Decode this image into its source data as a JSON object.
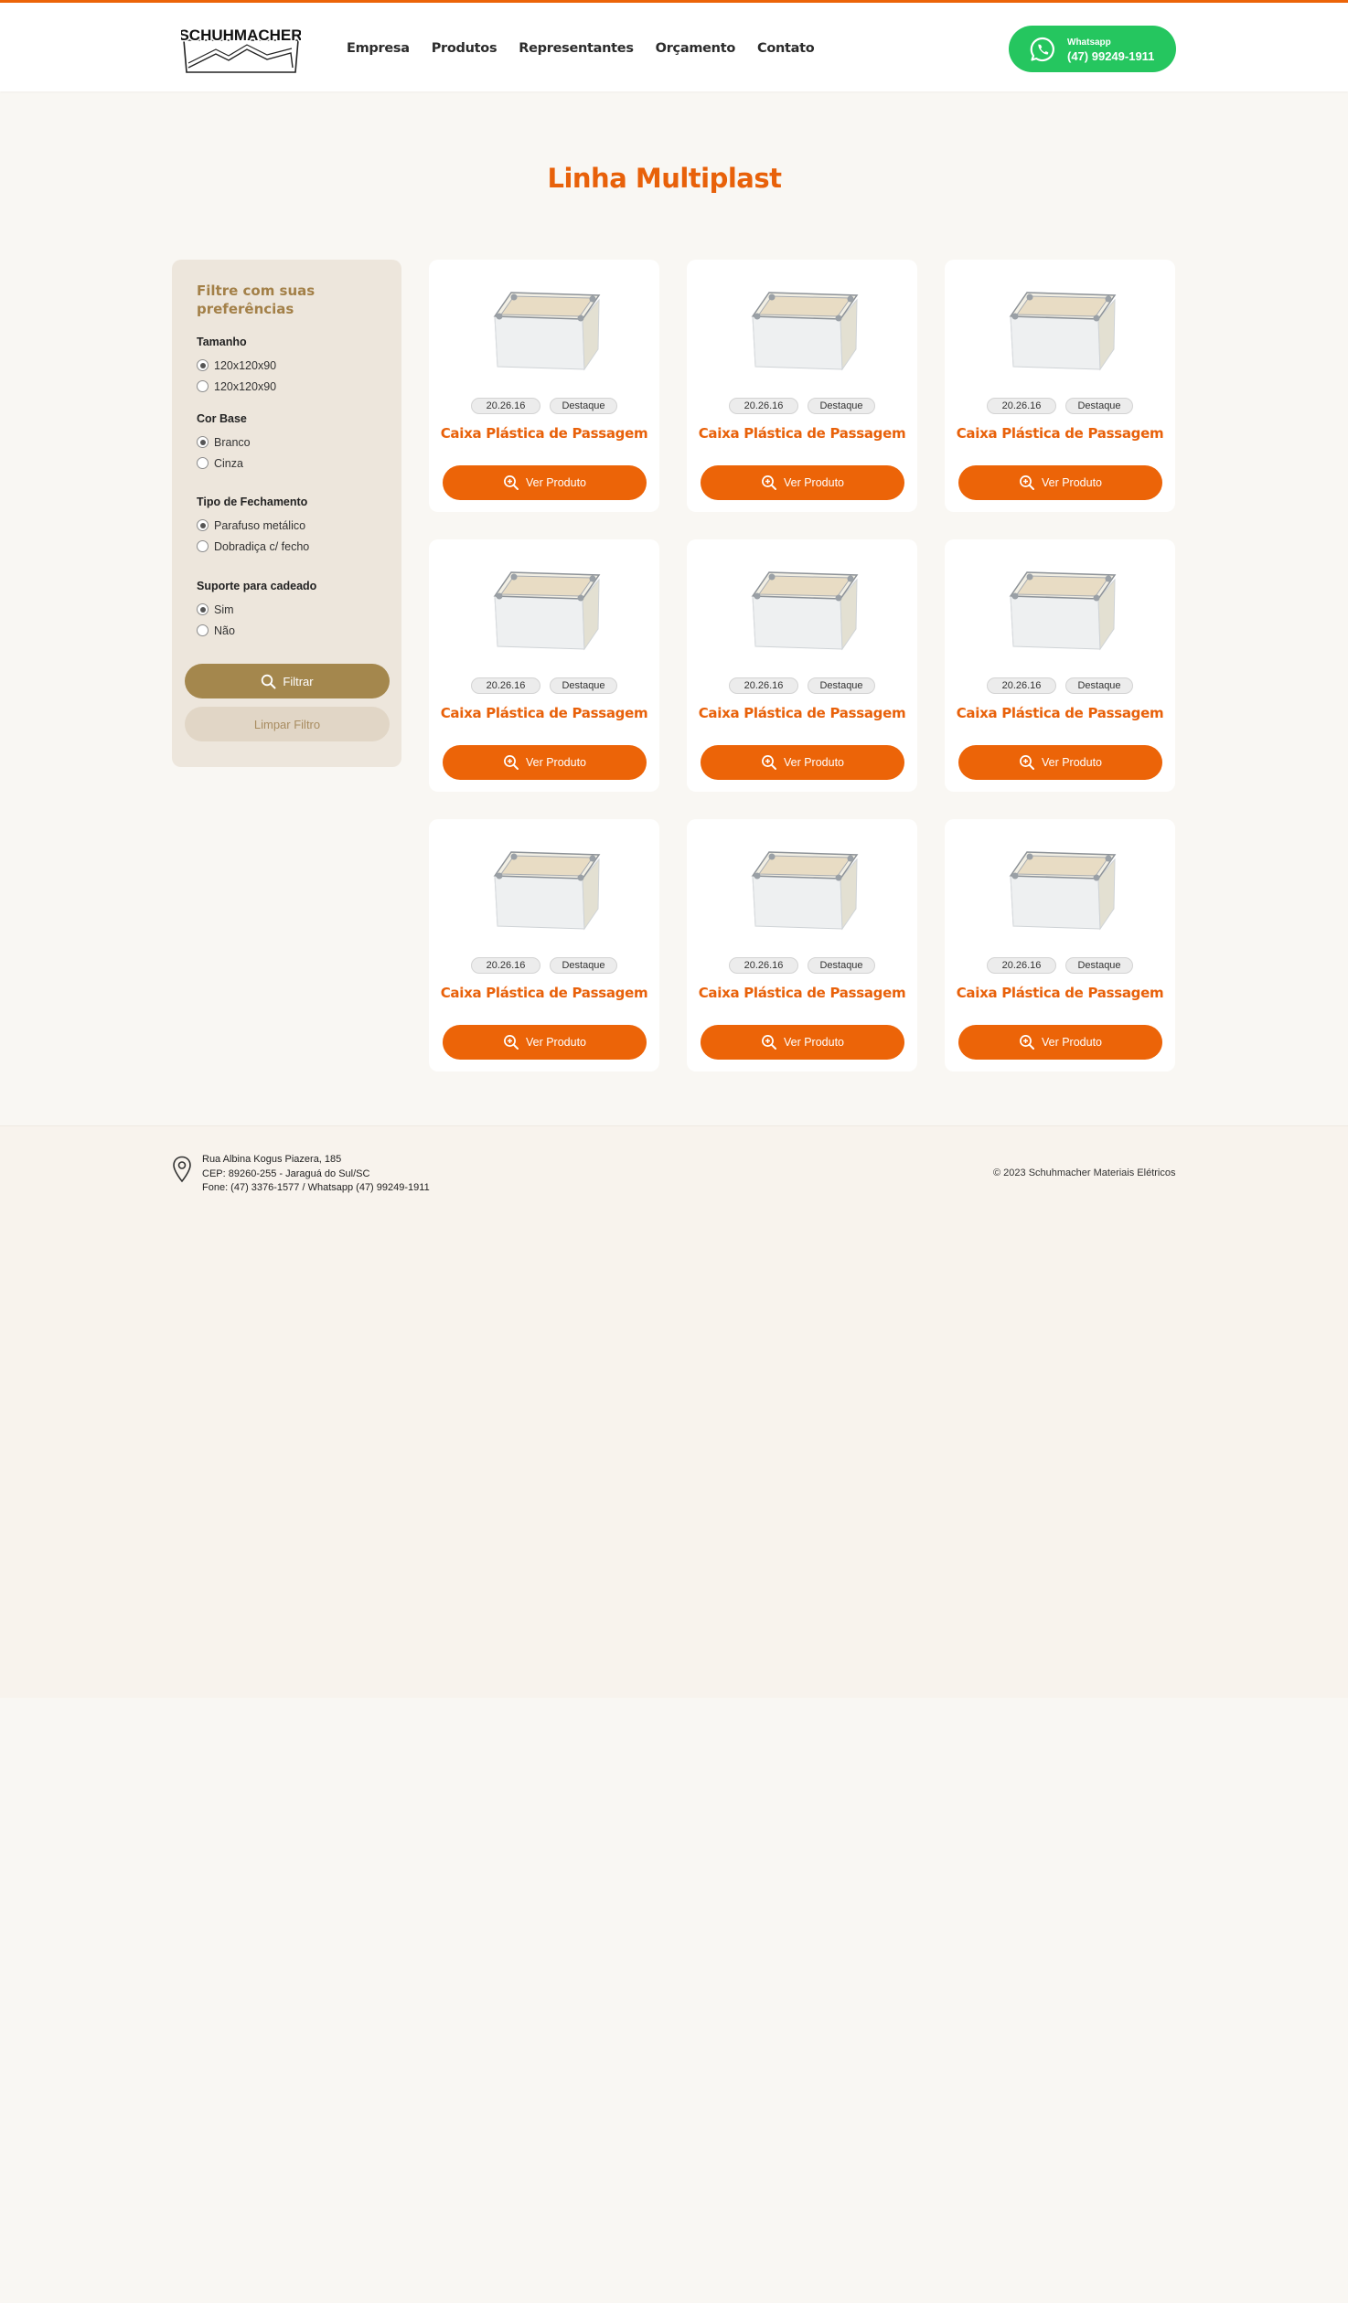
{
  "brand": {
    "logo_text": "SCHUHMACHER",
    "accent_color": "#ec6408",
    "whatsapp_color": "#25c65f"
  },
  "nav": {
    "items": [
      {
        "label": "Empresa"
      },
      {
        "label": "Produtos"
      },
      {
        "label": "Representantes"
      },
      {
        "label": "Orçamento"
      },
      {
        "label": "Contato"
      }
    ]
  },
  "whatsapp": {
    "label": "Whatsapp",
    "number": "(47) 99249-1911",
    "icon": "whatsapp-icon"
  },
  "page": {
    "title": "Linha Multiplast"
  },
  "filter": {
    "title": "Filtre com suas preferências",
    "groups": [
      {
        "title": "Tamanho",
        "options": [
          {
            "label": "120x120x90",
            "selected": true
          },
          {
            "label": "120x120x90",
            "selected": false
          }
        ]
      },
      {
        "title": "Cor Base",
        "options": [
          {
            "label": "Branco",
            "selected": true
          },
          {
            "label": "Cinza",
            "selected": false
          }
        ]
      },
      {
        "title": "Tipo de Fechamento",
        "options": [
          {
            "label": "Parafuso metálico",
            "selected": true
          },
          {
            "label": "Dobradiça c/ fecho",
            "selected": false
          }
        ]
      },
      {
        "title": "Suporte para cadeado",
        "options": [
          {
            "label": "Sim",
            "selected": true
          },
          {
            "label": "Não",
            "selected": false
          }
        ]
      }
    ],
    "filter_button": "Filtrar",
    "clear_button": "Limpar Filtro"
  },
  "products": [
    {
      "code": "20.26.16",
      "badge": "Destaque",
      "title": "Caixa Plástica de Passagem",
      "button": "Ver Produto"
    },
    {
      "code": "20.26.16",
      "badge": "Destaque",
      "title": "Caixa Plástica de Passagem",
      "button": "Ver Produto"
    },
    {
      "code": "20.26.16",
      "badge": "Destaque",
      "title": "Caixa Plástica de Passagem",
      "button": "Ver Produto"
    },
    {
      "code": "20.26.16",
      "badge": "Destaque",
      "title": "Caixa Plástica de Passagem",
      "button": "Ver Produto"
    },
    {
      "code": "20.26.16",
      "badge": "Destaque",
      "title": "Caixa Plástica de Passagem",
      "button": "Ver Produto"
    },
    {
      "code": "20.26.16",
      "badge": "Destaque",
      "title": "Caixa Plástica de Passagem",
      "button": "Ver Produto"
    },
    {
      "code": "20.26.16",
      "badge": "Destaque",
      "title": "Caixa Plástica de Passagem",
      "button": "Ver Produto"
    },
    {
      "code": "20.26.16",
      "badge": "Destaque",
      "title": "Caixa Plástica de Passagem",
      "button": "Ver Produto"
    },
    {
      "code": "20.26.16",
      "badge": "Destaque",
      "title": "Caixa Plástica de Passagem",
      "button": "Ver Produto"
    }
  ],
  "footer": {
    "address_lines": [
      "Rua Albina Kogus Piazera, 185",
      "CEP: 89260-255 - Jaraguá do Sul/SC",
      "Fone: (47) 3376-1577 / Whatsapp (47) 99249-1911"
    ],
    "copyright": "© 2023 Schuhmacher Materiais Elétricos"
  }
}
